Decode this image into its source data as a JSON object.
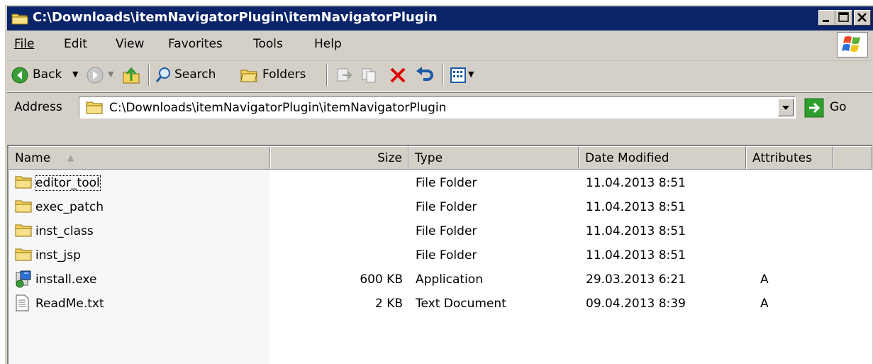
{
  "window": {
    "title": "C:\\Downloads\\itemNavigatorPlugin\\itemNavigatorPlugin"
  },
  "menu": {
    "items": [
      "File",
      "Edit",
      "View",
      "Favorites",
      "Tools",
      "Help"
    ]
  },
  "toolbar": {
    "back": "Back",
    "search": "Search",
    "folders": "Folders"
  },
  "address": {
    "label": "Address",
    "value": "C:\\Downloads\\itemNavigatorPlugin\\itemNavigatorPlugin",
    "go": "Go"
  },
  "list": {
    "columns": [
      "Name",
      "Size",
      "Type",
      "Date Modified",
      "Attributes"
    ],
    "rows": [
      {
        "name": "editor_tool",
        "size": "",
        "type": "File Folder",
        "date": "11.04.2013 8:51",
        "attr": "",
        "icon": "folder-icon"
      },
      {
        "name": "exec_patch",
        "size": "",
        "type": "File Folder",
        "date": "11.04.2013 8:51",
        "attr": "",
        "icon": "folder-icon"
      },
      {
        "name": "inst_class",
        "size": "",
        "type": "File Folder",
        "date": "11.04.2013 8:51",
        "attr": "",
        "icon": "folder-icon"
      },
      {
        "name": "inst_jsp",
        "size": "",
        "type": "File Folder",
        "date": "11.04.2013 8:51",
        "attr": "",
        "icon": "folder-icon"
      },
      {
        "name": "install.exe",
        "size": "600 KB",
        "type": "Application",
        "date": "29.03.2013 6:21",
        "attr": "A",
        "icon": "installer-icon"
      },
      {
        "name": "ReadMe.txt",
        "size": "2 KB",
        "type": "Text Document",
        "date": "09.04.2013 8:39",
        "attr": "A",
        "icon": "text-file-icon"
      }
    ]
  },
  "colors": {
    "titlebar": "#0a246a",
    "chrome": "#d4d0c8",
    "delete_red": "#e00000",
    "go_green": "#2e9e2e",
    "folder_yellow": "#f4d35e"
  }
}
